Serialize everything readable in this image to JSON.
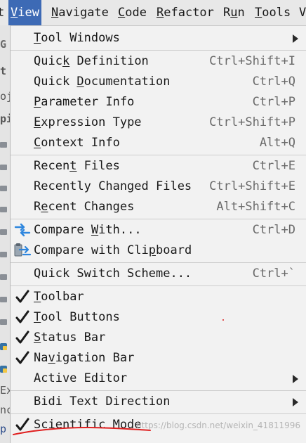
{
  "menubar": {
    "items": [
      {
        "label": "t",
        "mnemonic": ""
      },
      {
        "label": "View",
        "mnemonic": "V",
        "rest": "iew"
      },
      {
        "label": "Navigate",
        "mnemonic": "N",
        "rest": "avigate"
      },
      {
        "label": "Code",
        "mnemonic": "C",
        "rest": "ode"
      },
      {
        "label": "Refactor",
        "mnemonic": "R",
        "rest": "efactor"
      },
      {
        "label": "Run",
        "mnemonic": "",
        "pre": "R",
        "mid": "u",
        "post": "n"
      },
      {
        "label": "Tools",
        "mnemonic": "T",
        "rest": "ools"
      },
      {
        "label": "V",
        "mnemonic": ""
      }
    ]
  },
  "background": {
    "chars": [
      "G",
      "t",
      "oj",
      "pi",
      "Ex",
      "nc",
      "p"
    ]
  },
  "menu": {
    "tool_windows": {
      "pre": "",
      "u": "T",
      "post": "ool Windows"
    },
    "quick_definition": {
      "pre": "Quic",
      "u": "k",
      "post": " Definition",
      "shortcut": "Ctrl+Shift+I"
    },
    "quick_documentation": {
      "pre": "Quick ",
      "u": "D",
      "post": "ocumentation",
      "shortcut": "Ctrl+Q"
    },
    "parameter_info": {
      "pre": "",
      "u": "P",
      "post": "arameter Info",
      "shortcut": "Ctrl+P"
    },
    "expression_type": {
      "pre": "",
      "u": "E",
      "post": "xpression Type",
      "shortcut": "Ctrl+Shift+P"
    },
    "context_info": {
      "pre": "",
      "u": "C",
      "post": "ontext Info",
      "shortcut": "Alt+Q"
    },
    "recent_files": {
      "pre": "Recen",
      "u": "t",
      "post": " Files",
      "shortcut": "Ctrl+E"
    },
    "recently_changed_files": {
      "pre": "Recently Changed Files",
      "u": "",
      "post": "",
      "shortcut": "Ctrl+Shift+E"
    },
    "recent_changes": {
      "pre": "R",
      "u": "e",
      "post": "cent Changes",
      "shortcut": "Alt+Shift+C"
    },
    "compare_with": {
      "pre": "Compare ",
      "u": "W",
      "post": "ith...",
      "shortcut": "Ctrl+D"
    },
    "compare_clipboard": {
      "pre": "Compare with Cli",
      "u": "p",
      "post": "board",
      "shortcut": ""
    },
    "quick_switch_scheme": {
      "pre": "Quick Switch Scheme...",
      "u": "",
      "post": "",
      "shortcut": "Ctrl+`"
    },
    "toolbar": {
      "pre": "",
      "u": "T",
      "post": "oolbar",
      "checked": true
    },
    "tool_buttons": {
      "pre": "",
      "u": "T",
      "post": "ool Buttons",
      "checked": true
    },
    "status_bar": {
      "pre": "",
      "u": "S",
      "post": "tatus Bar",
      "checked": true
    },
    "navigation_bar": {
      "pre": "Na",
      "u": "v",
      "post": "igation Bar",
      "checked": true
    },
    "active_editor": {
      "pre": "Active Editor",
      "u": "",
      "post": ""
    },
    "bidi_text_direction": {
      "pre": "Bidi Text Direction",
      "u": "",
      "post": ""
    },
    "scientific_mode": {
      "pre": "Scientific Mode",
      "u": "",
      "post": "",
      "checked": true
    }
  },
  "watermark": "https://blog.csdn.net/weixin_41811996",
  "colors": {
    "menu_bg": "#f2f2f2",
    "active_menu_bg": "#3d6ab5",
    "check": "#1a1a1a",
    "annotation_red": "#e02020",
    "compare_icon": "#2e86de"
  }
}
